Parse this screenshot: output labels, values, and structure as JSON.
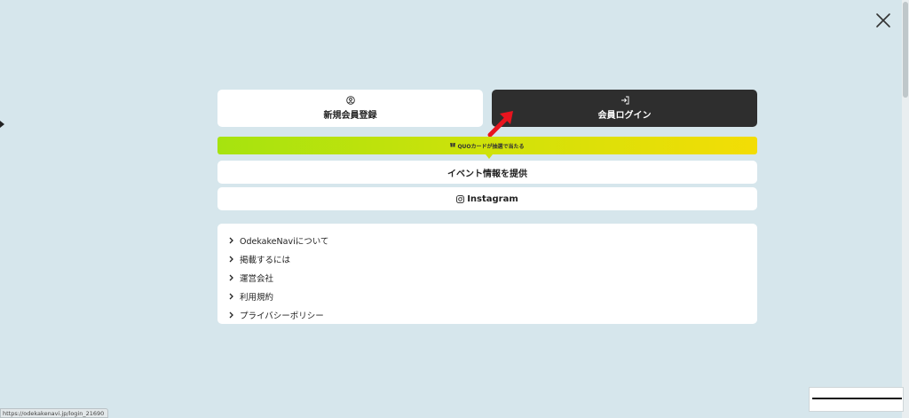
{
  "actions": {
    "register_label": "新規会員登録",
    "login_label": "会員ログイン"
  },
  "banner": {
    "text": "QUOカードが抽選で当たる"
  },
  "event_button": {
    "label": "イベント情報を提供"
  },
  "instagram_button": {
    "label": "Instagram"
  },
  "links": [
    {
      "label": "OdekakeNaviについて"
    },
    {
      "label": "掲載するには"
    },
    {
      "label": "運営会社"
    },
    {
      "label": "利用規約"
    },
    {
      "label": "プライバシーポリシー"
    }
  ],
  "status_bar": {
    "url": "https://odekakenavi.jp/login_21690"
  },
  "colors": {
    "background": "#d6e6ec",
    "login_bg": "#2e2e2e",
    "banner_start": "#a6e30f",
    "banner_end": "#f3dd05",
    "annotation_arrow": "#e8141e"
  },
  "icons": {
    "close": "close-icon",
    "register": "user-circle-icon",
    "login": "login-icon",
    "banner": "gift-icon",
    "instagram": "instagram-icon",
    "link": "chevron-right-icon"
  }
}
